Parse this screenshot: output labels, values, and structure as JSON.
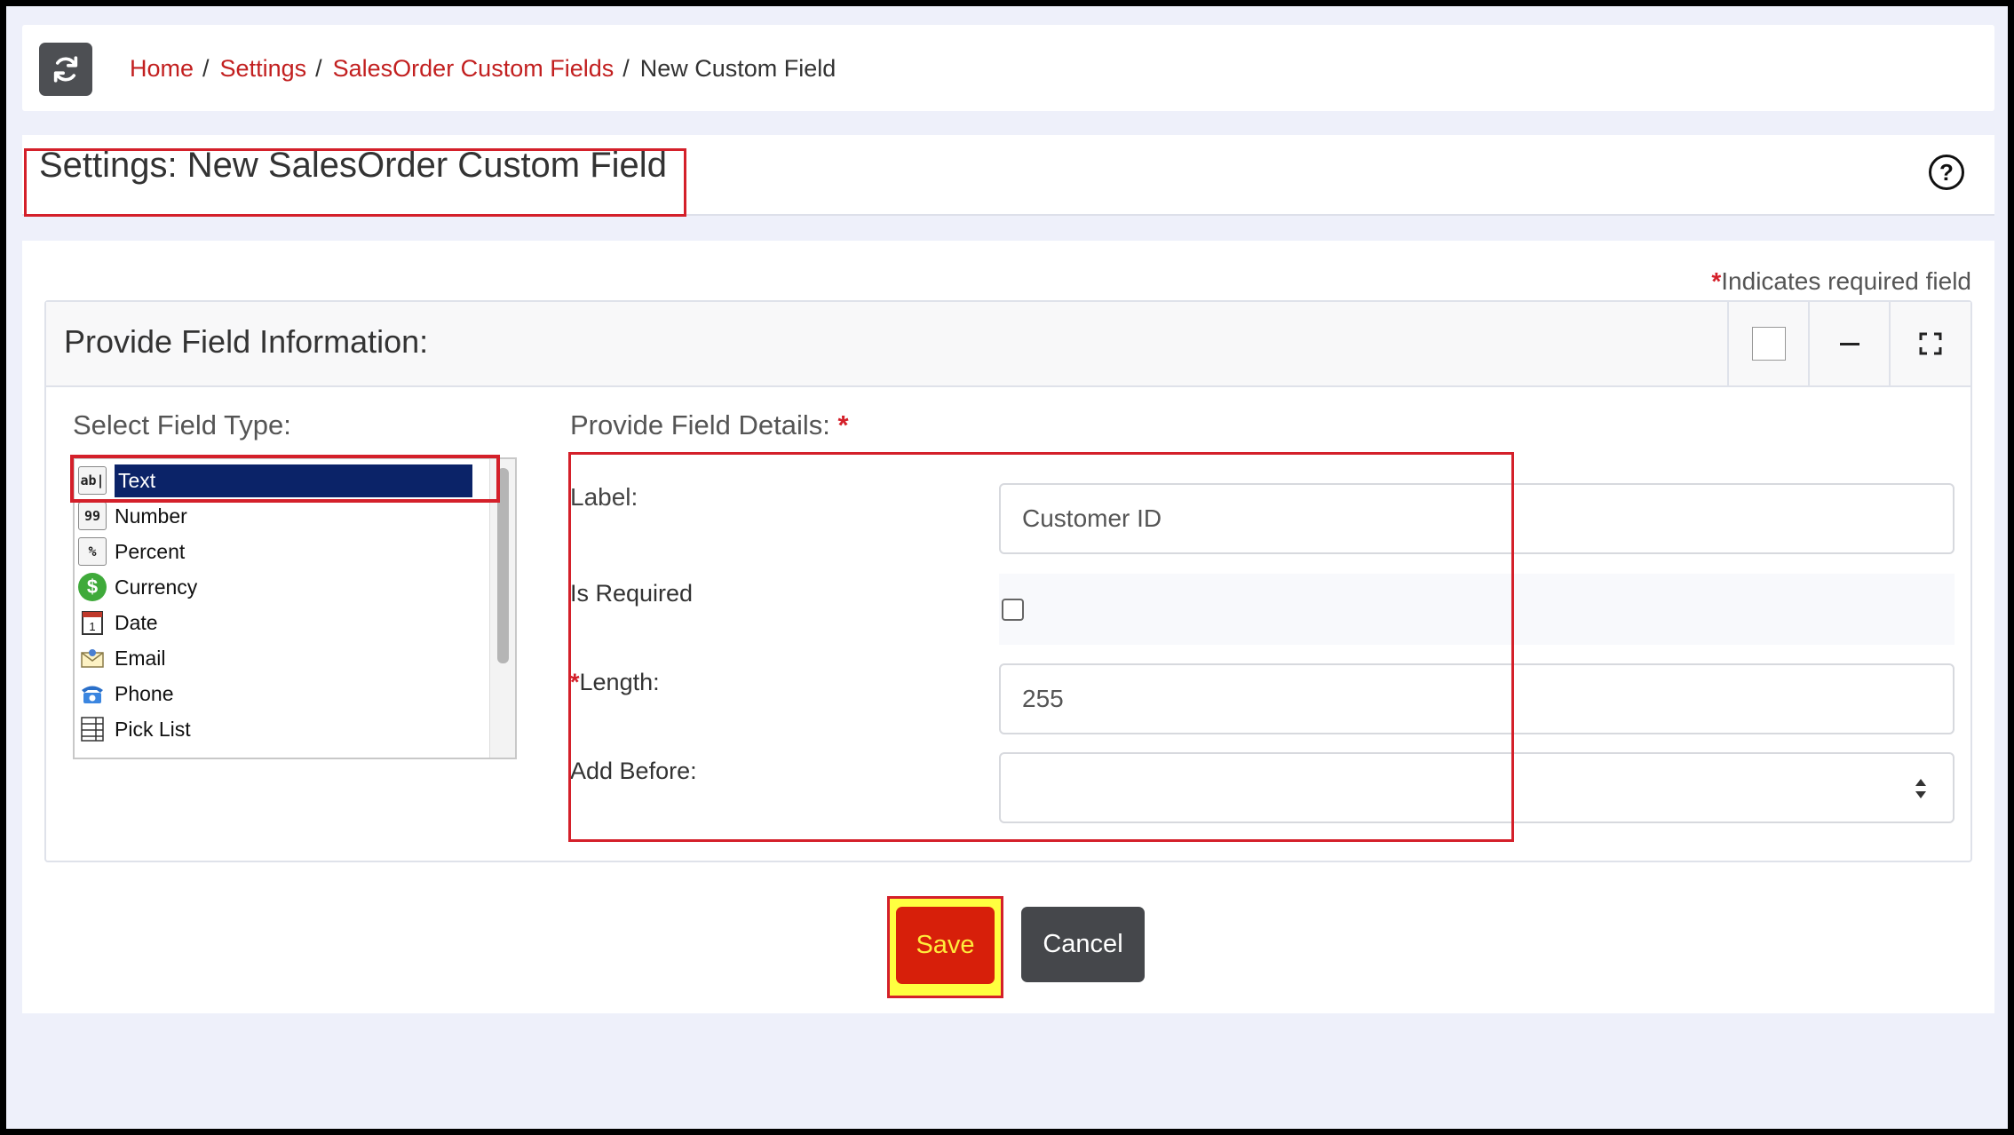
{
  "breadcrumb": {
    "home": "Home",
    "settings": "Settings",
    "custom_fields": "SalesOrder Custom Fields",
    "current": "New Custom Field",
    "separator": "/"
  },
  "header": {
    "title": "Settings: New SalesOrder Custom Field",
    "help_glyph": "?"
  },
  "required_note": {
    "star": "*",
    "text": "Indicates required field"
  },
  "panel": {
    "title": "Provide Field Information:",
    "tools": [
      "square-icon",
      "minimize-icon",
      "expand-icon"
    ]
  },
  "field_type": {
    "label": "Select Field Type:",
    "selected": "Text",
    "items": [
      {
        "label": "Text",
        "icon": "text-field-icon",
        "glyph": "ab|"
      },
      {
        "label": "Number",
        "icon": "number-field-icon",
        "glyph": "99"
      },
      {
        "label": "Percent",
        "icon": "percent-field-icon",
        "glyph": "%"
      },
      {
        "label": "Currency",
        "icon": "currency-field-icon",
        "glyph": "$"
      },
      {
        "label": "Date",
        "icon": "date-field-icon",
        "glyph": "1"
      },
      {
        "label": "Email",
        "icon": "email-field-icon",
        "glyph": ""
      },
      {
        "label": "Phone",
        "icon": "phone-field-icon",
        "glyph": ""
      },
      {
        "label": "Pick List",
        "icon": "picklist-field-icon",
        "glyph": ""
      }
    ]
  },
  "details": {
    "label": "Provide Field Details:",
    "star": "*",
    "label_field": {
      "label": "Label:",
      "value": "Customer ID"
    },
    "is_required": {
      "label": "Is Required",
      "checked": false
    },
    "length": {
      "star": "*",
      "label": "Length:",
      "value": "255"
    },
    "add_before": {
      "label": "Add Before:",
      "value": ""
    }
  },
  "actions": {
    "save": "Save",
    "cancel": "Cancel"
  },
  "colors": {
    "link": "#c21f1f",
    "highlight": "#d4202a",
    "selected_row": "#0b2368",
    "save_bg": "#d71f0a",
    "save_text": "#ffeb3b",
    "cancel_bg": "#45474b"
  }
}
